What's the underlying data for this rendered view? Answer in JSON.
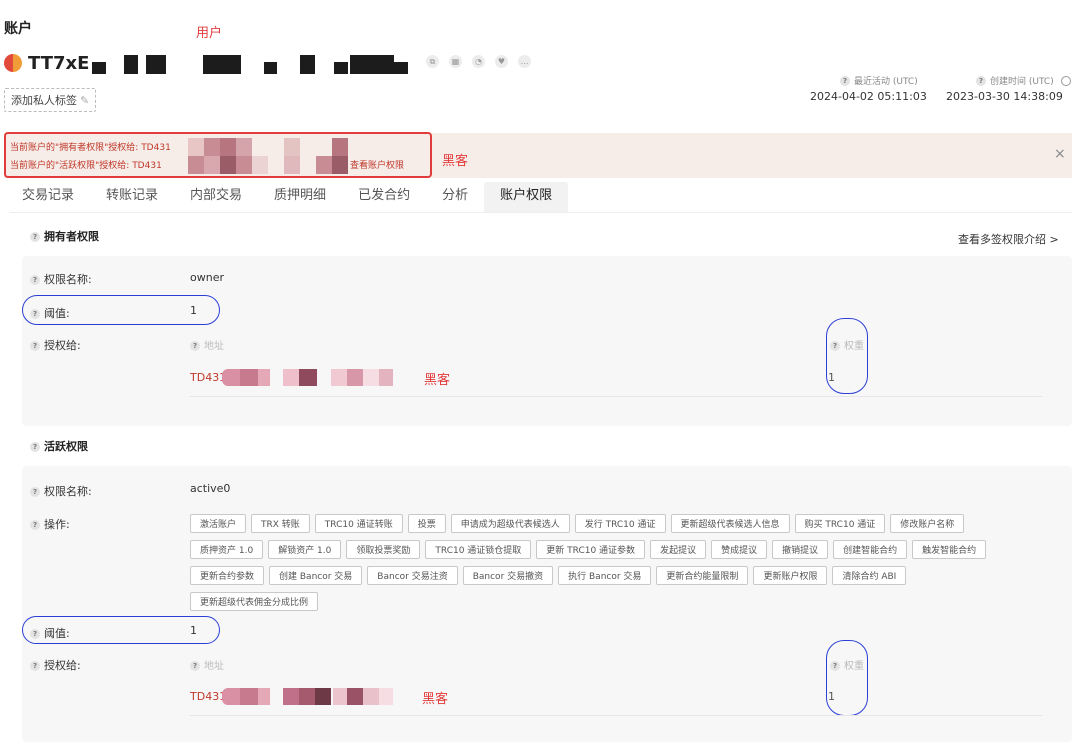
{
  "header": {
    "title": "账户",
    "annotation_user": "用户",
    "account_name": "TT7xE",
    "add_tag_label": "添加私人标签"
  },
  "meta": {
    "last_active_label": "最近活动 (UTC)",
    "last_active_value": "2024-04-02 05:11:03",
    "created_label": "创建时间 (UTC)",
    "created_value": "2023-03-30 14:38:09"
  },
  "banner": {
    "owner_line": "当前账户的\"拥有者权限\"授权给:",
    "owner_addr": "TD431",
    "active_line": "当前账户的\"活跃权限\"授权给:",
    "active_addr": "TD431",
    "view_link": "查看账户权限",
    "annotation": "黑客",
    "close": "×"
  },
  "tabs": [
    "交易记录",
    "转账记录",
    "内部交易",
    "质押明细",
    "已发合约",
    "分析",
    "账户权限"
  ],
  "owner": {
    "section_title": "拥有者权限",
    "multisig_link": "查看多签权限介绍 >",
    "name_label": "权限名称:",
    "name_value": "owner",
    "threshold_label": "阈值:",
    "threshold_value": "1",
    "grant_label": "授权给:",
    "address_header": "地址",
    "weight_header": "权重",
    "address": "TD431",
    "hacker": "黑客",
    "weight": "1"
  },
  "active": {
    "section_title": "活跃权限",
    "name_label": "权限名称:",
    "name_value": "active0",
    "ops_label": "操作:",
    "operations": [
      "激活账户",
      "TRX 转账",
      "TRC10 通证转账",
      "投票",
      "申请成为超级代表候选人",
      "发行 TRC10 通证",
      "更新超级代表候选人信息",
      "购买 TRC10 通证",
      "修改账户名称",
      "质押资产 1.0",
      "解锁资产 1.0",
      "领取投票奖励",
      "TRC10 通证锁仓提取",
      "更新 TRC10 通证参数",
      "发起提议",
      "赞成提议",
      "撤销提议",
      "创建智能合约",
      "触发智能合约",
      "更新合约参数",
      "创建 Bancor 交易",
      "Bancor 交易注资",
      "Bancor 交易撤资",
      "执行 Bancor 交易",
      "更新合约能量限制",
      "更新账户权限",
      "清除合约 ABI",
      "更新超级代表佣金分成比例"
    ],
    "threshold_label": "阈值:",
    "threshold_value": "1",
    "grant_label": "授权给:",
    "address_header": "地址",
    "weight_header": "权重",
    "address": "TD431",
    "hacker": "黑客",
    "weight": "1"
  }
}
